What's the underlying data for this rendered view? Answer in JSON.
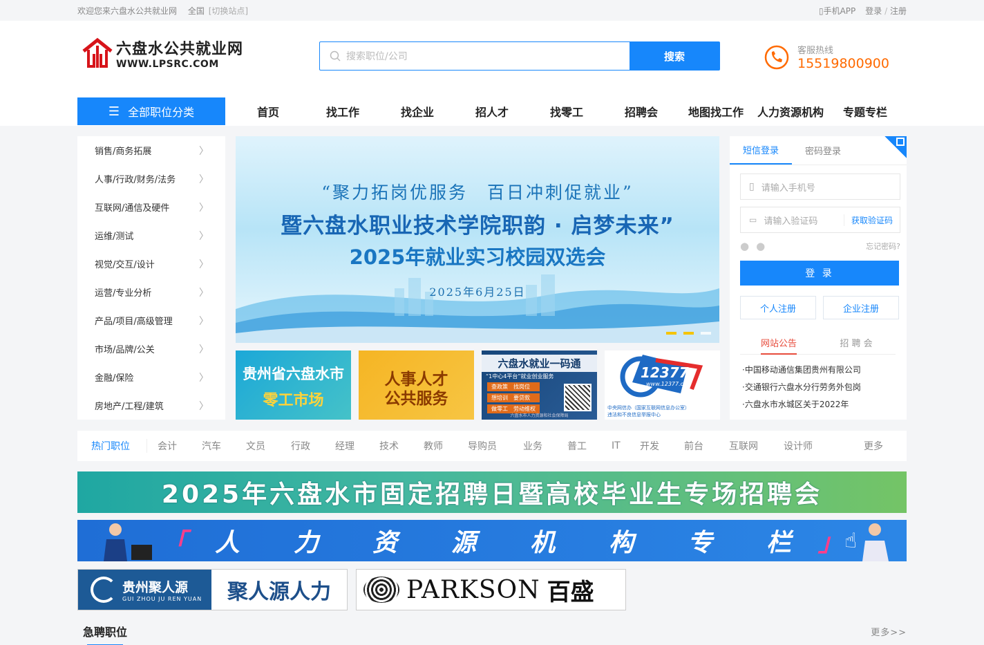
{
  "topbar": {
    "welcome": "欢迎您来六盘水公共就业网",
    "region": "全国",
    "switch_site": "[切换站点]",
    "app": "手机APP",
    "login": "登录",
    "sep": "/",
    "register": "注册"
  },
  "header": {
    "logo_cn": "六盘水公共就业网",
    "logo_en": "WWW.LPSRC.COM",
    "search_placeholder": "搜索职位/公司",
    "search_button": "搜索",
    "hotline_label": "客服热线",
    "hotline_number": "15519800900"
  },
  "nav": {
    "all_categories": "全部职位分类",
    "items": [
      "首页",
      "找工作",
      "找企业",
      "招人才",
      "找零工",
      "招聘会",
      "地图找工作",
      "人力资源机构",
      "专题专栏"
    ]
  },
  "categories": [
    "销售/商务拓展",
    "人事/行政/财务/法务",
    "互联网/通信及硬件",
    "运维/测试",
    "视觉/交互/设计",
    "运营/专业分析",
    "产品/项目/高级管理",
    "市场/品牌/公关",
    "金融/保险",
    "房地产/工程/建筑"
  ],
  "banner": {
    "line1": "“聚力拓岗优服务　百日冲刺促就业”",
    "line2": "暨六盘水职业技术学院职韵 · 启梦未来”",
    "line3": "2025年就业实习校园双选会",
    "date": "2025年6月25日"
  },
  "tiles": {
    "t1_line1": "贵州省六盘水市",
    "t1_line2": "零工市场",
    "t2_line1": "人事人才",
    "t2_line2": "公共服务",
    "t3_title": "六盘水就业一码通",
    "t3_sub": "“1中心4平台”就业创业服务",
    "t3_items": [
      "查政策　找岗位",
      "想培训　要贷款",
      "做零工　劳动维权"
    ],
    "t3_foot": "六盘水市人力资源和社会保障局",
    "t4_num": "12377",
    "t4_url": "www.12377.cn",
    "t4_foot1": "中央网信办（国家互联网信息办公室）",
    "t4_foot2": "违法和不良信息举报中心"
  },
  "login": {
    "tab_sms": "短信登录",
    "tab_password": "密码登录",
    "phone_placeholder": "请输入手机号",
    "code_placeholder": "请输入验证码",
    "get_code": "获取验证码",
    "forgot": "忘记密码?",
    "login_button": "登 录",
    "personal_register": "个人注册",
    "company_register": "企业注册",
    "notice_tab": "网站公告",
    "fair_tab": "招 聘 会",
    "notices": [
      "·中国移动通信集团贵州有限公司",
      "·交通银行六盘水分行劳务外包岗",
      "·六盘水市水城区关于2022年"
    ]
  },
  "hot_jobs": {
    "title": "热门职位",
    "tags": [
      "会计",
      "汽车",
      "文员",
      "行政",
      "经理",
      "技术",
      "教师",
      "导购员",
      "业务",
      "普工",
      "IT",
      "开发",
      "前台",
      "互联网",
      "设计师"
    ],
    "more": "更多"
  },
  "ads": {
    "ad1": "2025年六盘水市固定招聘日暨高校毕业生专场招聘会",
    "ad2_chars": [
      "「",
      "人",
      "力",
      "资",
      "源",
      "机",
      "构",
      "专",
      "栏",
      "」"
    ]
  },
  "brands": {
    "b1_cn": "贵州聚人源",
    "b1_en": "GUI ZHOU JU REN YUAN",
    "b1_right": "聚人源人力",
    "b2_en": "PARKSON",
    "b2_cn": "百盛"
  },
  "urgent": {
    "title": "急聘职位",
    "more": "更多>>"
  },
  "colors": {
    "primary": "#1787fb",
    "hotline": "#ff6a00",
    "notice_active": "#e74c3c"
  }
}
